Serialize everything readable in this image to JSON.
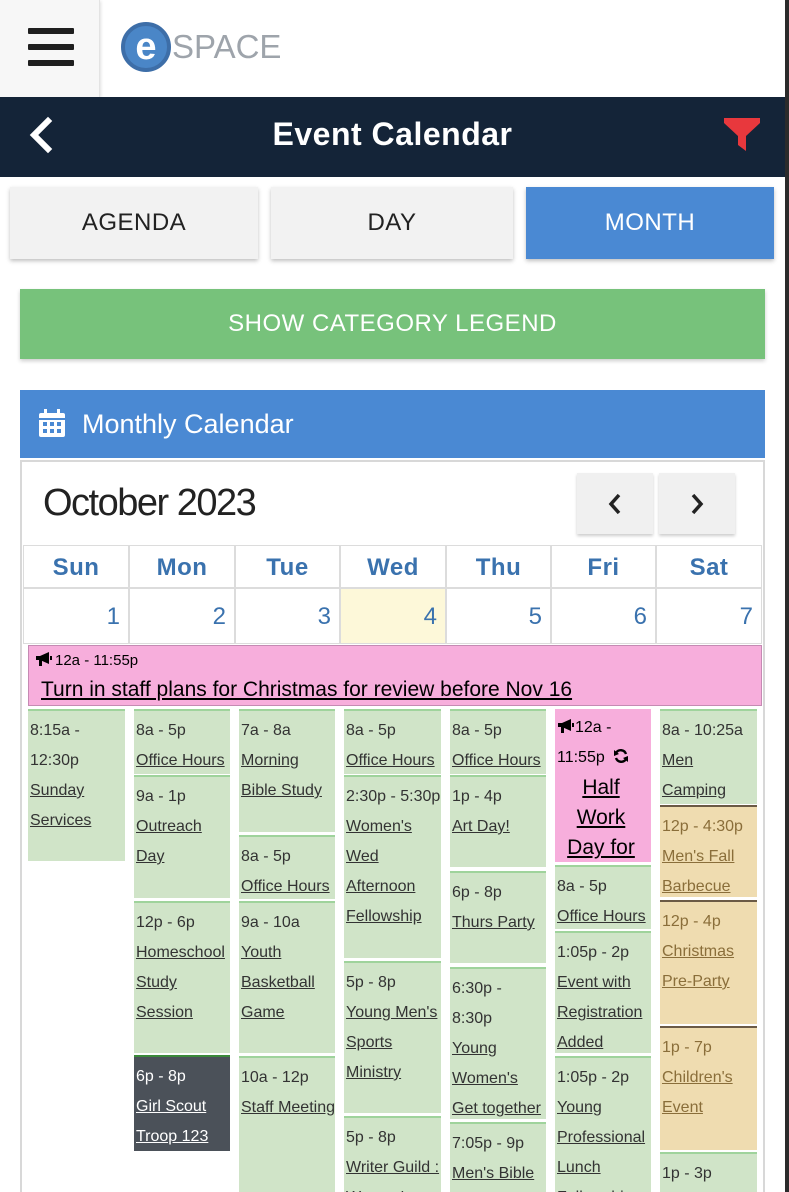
{
  "app": {
    "logo_letter": "e",
    "logo_text": "SPACE"
  },
  "header": {
    "title": "Event Calendar"
  },
  "tabs": [
    {
      "label": "AGENDA"
    },
    {
      "label": "DAY"
    },
    {
      "label": "MONTH"
    }
  ],
  "legend_button": "SHOW CATEGORY LEGEND",
  "panel_title": "Monthly Calendar",
  "month_title": "October 2023",
  "weekdays": [
    "Sun",
    "Mon",
    "Tue",
    "Wed",
    "Thu",
    "Fri",
    "Sat"
  ],
  "dates": [
    "1",
    "2",
    "3",
    "4",
    "5",
    "6",
    "7"
  ],
  "all_day_event": {
    "time": "12a - 11:55p",
    "title": "Turn in staff plans for Christmas for review before Nov 16"
  },
  "events": {
    "sun": [
      {
        "time": "8:15a - 12:30p",
        "title": "Sunday Services"
      }
    ],
    "mon": [
      {
        "time": "8a - 5p",
        "title": "Office Hours"
      },
      {
        "time": "9a - 1p",
        "title": "Outreach Day"
      },
      {
        "time": "12p - 6p",
        "title": "Homeschool Study Session"
      },
      {
        "time": "6p - 8p",
        "title": "Girl Scout Troop 123"
      }
    ],
    "tue": [
      {
        "time": "7a - 8a",
        "title": "Morning Bible Study"
      },
      {
        "time": "8a - 5p",
        "title": "Office Hours"
      },
      {
        "time": "9a - 10a",
        "title": "Youth Basketball Game"
      },
      {
        "time": "10a - 12p",
        "title": "Staff Meeting"
      }
    ],
    "wed": [
      {
        "time": "8a - 5p",
        "title": "Office Hours"
      },
      {
        "time": "2:30p - 5:30p",
        "title": "Women's Wed Afternoon Fellowship"
      },
      {
        "time": "5p - 8p",
        "title": "Young Men's Sports Ministry"
      },
      {
        "time": "5p - 8p",
        "title": "Writer Guild : Women's"
      }
    ],
    "thu": [
      {
        "time": "8a - 5p",
        "title": "Office Hours"
      },
      {
        "time": "1p - 4p",
        "title": "Art Day!"
      },
      {
        "time": "6p - 8p",
        "title": "Thurs Party"
      },
      {
        "time": "6:30p - 8:30p",
        "title": "Young Women's Get together"
      },
      {
        "time": "7:05p - 9p",
        "title": "Men's Bible"
      }
    ],
    "fri": [
      {
        "time": "12a - 11:55p",
        "title": "Half Work Day for Staff"
      },
      {
        "time": "8a - 5p",
        "title": "Office Hours"
      },
      {
        "time": "1:05p - 2p",
        "title": "Event with Registration Added"
      },
      {
        "time": "1:05p - 2p",
        "title": "Young Professional Lunch Fellowship"
      }
    ],
    "sat": [
      {
        "time": "8a - 10:25a",
        "title": "Men Camping Trip"
      },
      {
        "time": "12p - 4:30p",
        "title": "Men's Fall Barbecue"
      },
      {
        "time": "12p - 4p",
        "title": "Christmas Pre-Party"
      },
      {
        "time": "1p - 7p",
        "title": "Children's Event"
      },
      {
        "time": "1p - 3p",
        "title": ""
      }
    ]
  },
  "colors": {
    "header_bg": "#142438",
    "accent_blue": "#4a89d3",
    "legend_green": "#77c27b",
    "event_green": "#d0e4c8",
    "event_tan": "#efdcb0",
    "event_pink": "#f7aedc",
    "event_dark": "#4b5159",
    "filter_red": "#e8383d",
    "today_bg": "#fdf8d9"
  },
  "icons": {
    "menu": "hamburger-icon",
    "back": "chevron-left-icon",
    "filter": "funnel-icon",
    "calendar": "calendar-icon",
    "prev": "chevron-left-icon",
    "next": "chevron-right-icon",
    "announcement": "megaphone-icon",
    "recurring": "refresh-icon"
  }
}
